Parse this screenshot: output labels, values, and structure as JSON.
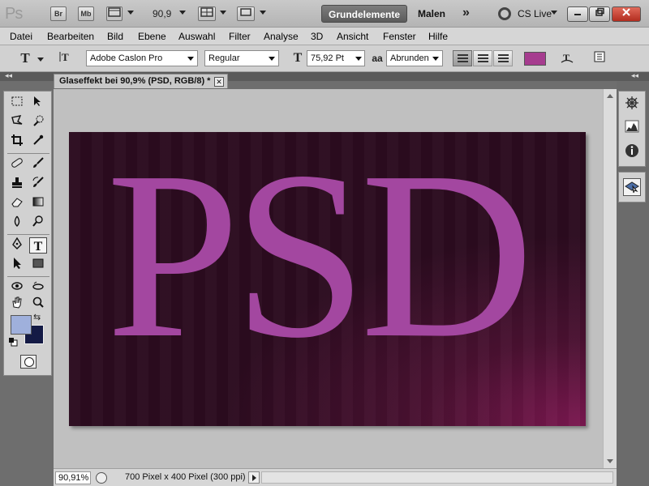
{
  "titlebar": {
    "app_logo": "Ps",
    "bridge_label": "Br",
    "minibridge_label": "Mb",
    "zoom_value": "90,9",
    "workspace_active": "Grundelemente",
    "workspace_other": "Malen",
    "more_workspaces": "»",
    "cs_live": "CS Live"
  },
  "menu": [
    "Datei",
    "Bearbeiten",
    "Bild",
    "Ebene",
    "Auswahl",
    "Filter",
    "Analyse",
    "3D",
    "Ansicht",
    "Fenster",
    "Hilfe"
  ],
  "options": {
    "tool_glyph": "T",
    "font_family": "Adobe Caslon Pro",
    "font_style": "Regular",
    "font_size": "75,92 Pt",
    "antialias_label": "aa",
    "antialias": "Abrunden",
    "text_color": "#a63c8f"
  },
  "document": {
    "tab_title": "Glaseffekt bei 90,9% (PSD, RGB/8) *",
    "tab_close": "✕",
    "canvas_text": "PSD",
    "text_color": "#a347a0"
  },
  "statusbar": {
    "zoom": "90,91%",
    "doc_info": "700 Pixel x 400 Pixel (300 ppi)"
  },
  "colors": {
    "foreground": "#9fb0dc",
    "background": "#141a45"
  }
}
